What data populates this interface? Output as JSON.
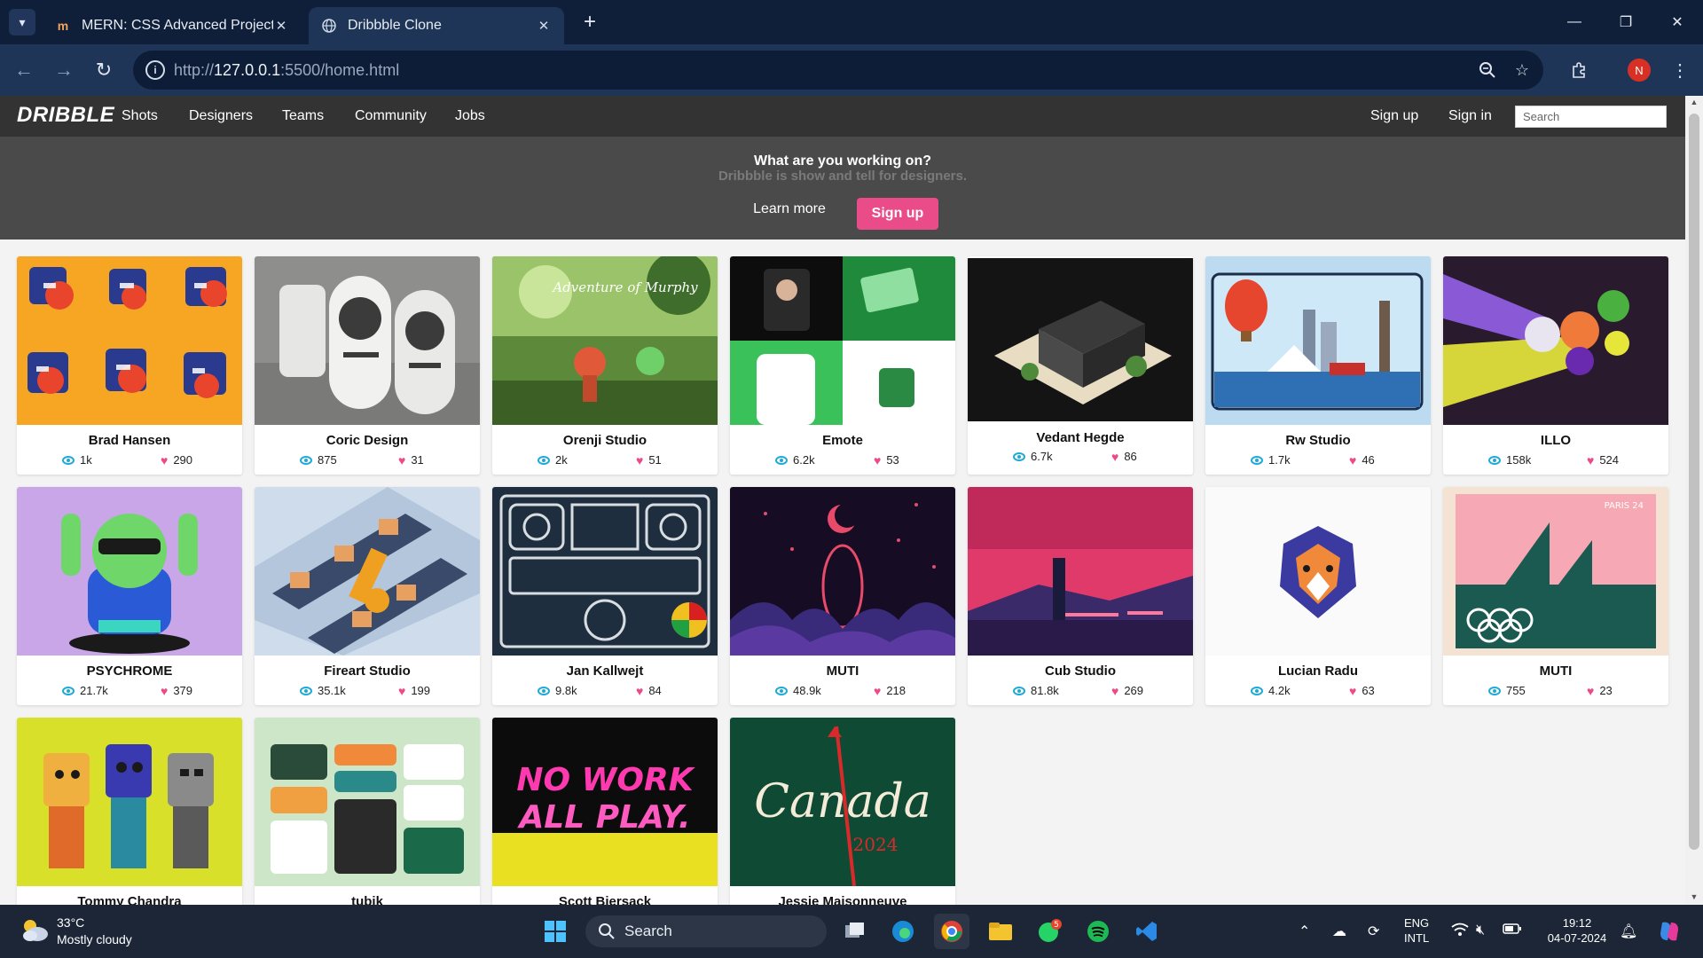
{
  "browser": {
    "tabs": [
      {
        "title": "MERN: CSS Advanced Project | S",
        "favicon": "udemy-icon",
        "active": false
      },
      {
        "title": "Dribbble Clone",
        "favicon": "globe-icon",
        "active": true
      }
    ],
    "url_scheme": "http://",
    "url_host": "127.0.0.1",
    "url_path": ":5500/home.html",
    "profile_initial": "N"
  },
  "navbar": {
    "logo": "DRIBBLE",
    "links": [
      "Shots",
      "Designers",
      "Teams",
      "Community",
      "Jobs"
    ],
    "signup": "Sign up",
    "signin": "Sign in",
    "search_placeholder": "Search"
  },
  "hero": {
    "title": "What are you working on?",
    "subtitle": "Dribbble is show and tell for designers.",
    "learn_more": "Learn more",
    "signup": "Sign up"
  },
  "shots": [
    {
      "name": "Brad Hansen",
      "views": "1k",
      "likes": "290"
    },
    {
      "name": "Coric Design",
      "views": "875",
      "likes": "31"
    },
    {
      "name": "Orenji Studio",
      "views": "2k",
      "likes": "51"
    },
    {
      "name": "Emote",
      "views": "6.2k",
      "likes": "53"
    },
    {
      "name": "Vedant Hegde",
      "views": "6.7k",
      "likes": "86"
    },
    {
      "name": "Rw Studio",
      "views": "1.7k",
      "likes": "46"
    },
    {
      "name": "ILLO",
      "views": "158k",
      "likes": "524"
    },
    {
      "name": "PSYCHROME",
      "views": "21.7k",
      "likes": "379"
    },
    {
      "name": "Fireart Studio",
      "views": "35.1k",
      "likes": "199"
    },
    {
      "name": "Jan Kallwejt",
      "views": "9.8k",
      "likes": "84"
    },
    {
      "name": "MUTI",
      "views": "48.9k",
      "likes": "218"
    },
    {
      "name": "Cub Studio",
      "views": "81.8k",
      "likes": "269"
    },
    {
      "name": "Lucian Radu",
      "views": "4.2k",
      "likes": "63"
    },
    {
      "name": "MUTI",
      "views": "755",
      "likes": "23"
    },
    {
      "name": "Tommy Chandra",
      "views": "",
      "likes": ""
    },
    {
      "name": "tubik",
      "views": "",
      "likes": ""
    },
    {
      "name": "Scott Biersack",
      "views": "",
      "likes": ""
    },
    {
      "name": "Jessie Maisonneuve",
      "views": "",
      "likes": ""
    }
  ],
  "shot_art": {
    "paris_label": "PARIS 24",
    "adventure_label": "Adventure of Murphy",
    "nowork_line1": "NO WORK",
    "nowork_line2": "ALL PLAY.",
    "canada_word": "Canada",
    "canada_year": "2024"
  },
  "taskbar": {
    "temperature": "33°C",
    "weather": "Mostly cloudy",
    "search": "Search",
    "lang_line1": "ENG",
    "lang_line2": "INTL",
    "time": "19:12",
    "date": "04-07-2024",
    "whatsapp_badge": "5"
  },
  "colors": {
    "accent_pink": "#ea4c89",
    "navbar_bg": "#333333",
    "hero_bg": "#4a4a4a",
    "eye_blue": "#1fa9d6"
  }
}
